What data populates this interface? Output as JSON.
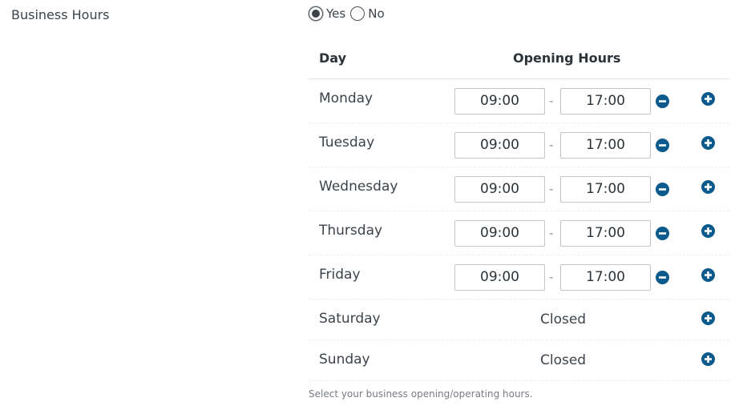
{
  "field": {
    "label": "Business Hours"
  },
  "toggle": {
    "yes_label": "Yes",
    "no_label": "No",
    "selected": "Yes"
  },
  "table": {
    "headers": {
      "day": "Day",
      "hours": "Opening Hours"
    },
    "rows": [
      {
        "day": "Monday",
        "open": "09:00",
        "close": "17:00"
      },
      {
        "day": "Tuesday",
        "open": "09:00",
        "close": "17:00"
      },
      {
        "day": "Wednesday",
        "open": "09:00",
        "close": "17:00"
      },
      {
        "day": "Thursday",
        "open": "09:00",
        "close": "17:00"
      },
      {
        "day": "Friday",
        "open": "09:00",
        "close": "17:00"
      },
      {
        "day": "Saturday",
        "status": "Closed"
      },
      {
        "day": "Sunday",
        "status": "Closed"
      }
    ],
    "separator": "-"
  },
  "help_text": "Select your business opening/operating hours.",
  "colors": {
    "icon_button": "#0a5a8c",
    "text": "#3c434a",
    "border": "#c3c4c7"
  },
  "icons": {
    "remove": "minus-circle-icon",
    "add": "plus-circle-icon"
  }
}
